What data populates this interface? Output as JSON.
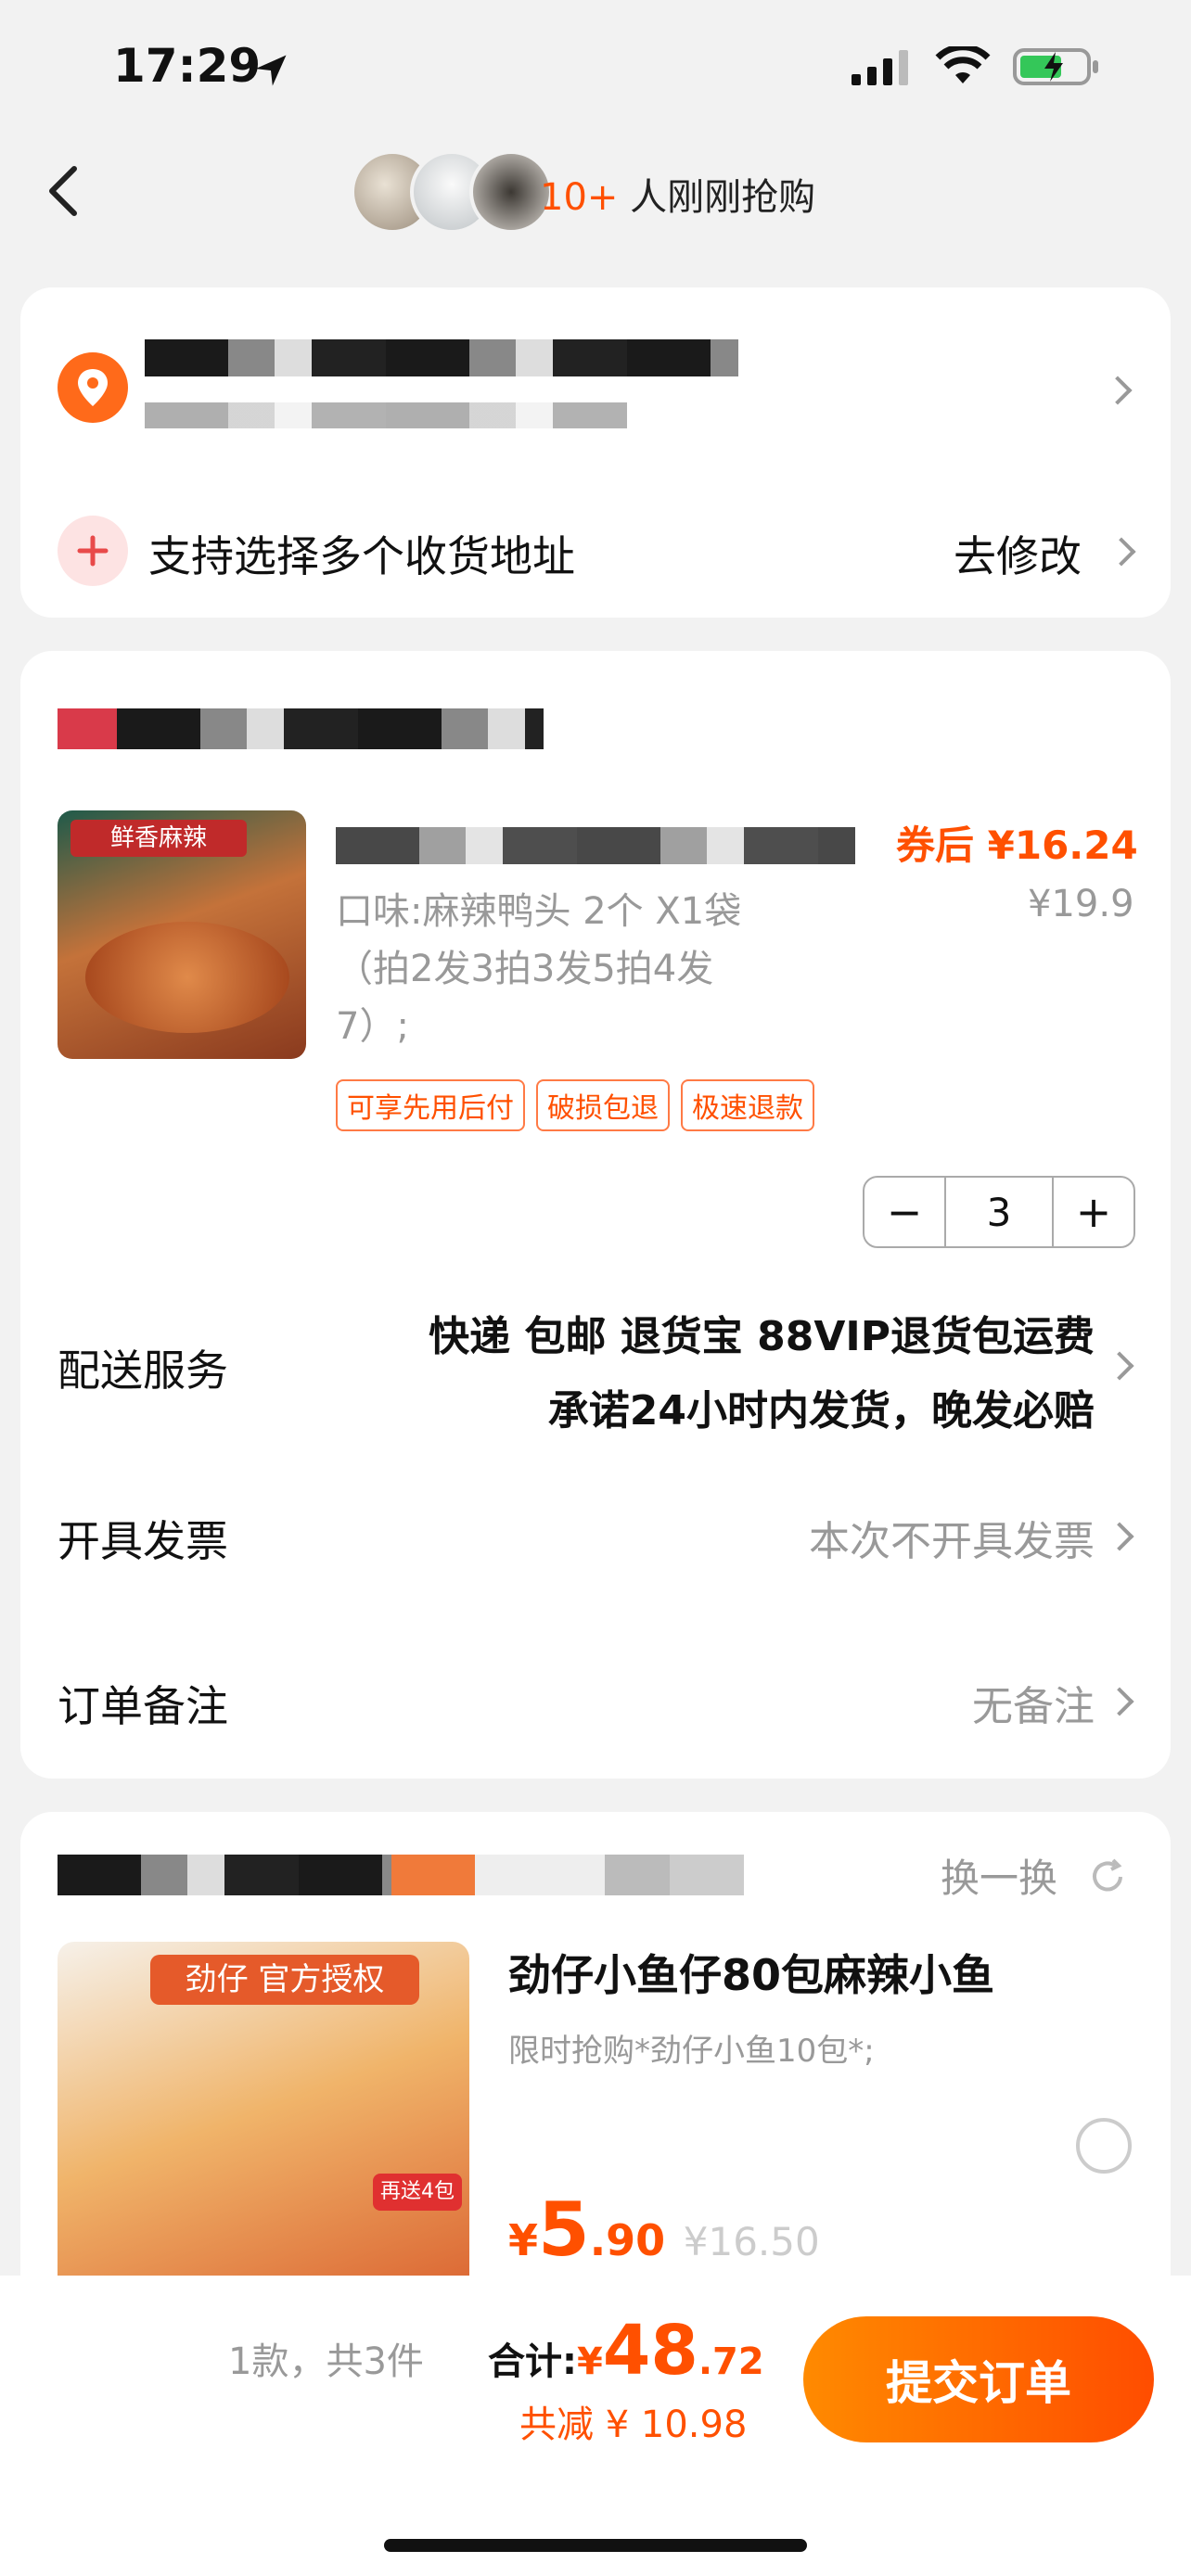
{
  "status": {
    "time": "17:29"
  },
  "header": {
    "count": "10+",
    "text": "人刚刚抢购"
  },
  "address": {
    "multi": "支持选择多个收货地址",
    "edit": "去修改"
  },
  "product": {
    "spec_line1": "口味:麻辣鸭头 2个 X1袋",
    "spec_line2": "（拍2发3拍3发5拍4发",
    "spec_line3": "7）;",
    "coupon_label": "券后",
    "price_after": "¥16.24",
    "price_orig": "¥19.9",
    "tags": [
      "可享先用后付",
      "破损包退",
      "极速退款"
    ],
    "quantity": "3",
    "image_caption": "鲜香麻辣"
  },
  "rows": {
    "delivery_label": "配送服务",
    "delivery_line1": "快递 包邮 退货宝 88VIP退货包运费",
    "delivery_line2": "承诺24小时内发货，晚发必赔",
    "invoice_label": "开具发票",
    "invoice_value": "本次不开具发票",
    "note_label": "订单备注",
    "note_value": "无备注"
  },
  "recommend": {
    "swap": "换一换",
    "title": "劲仔小鱼仔80包麻辣小鱼",
    "subtitle": "限时抢购*劲仔小鱼10包*;",
    "price_symbol": "¥",
    "price_int": "5",
    "price_dec": ".90",
    "price_orig": "¥16.50",
    "image_brand": "劲仔",
    "image_badge": "官方授权",
    "image_promo": "再送4包"
  },
  "footer": {
    "summary": "1款，共3件",
    "total_label": "合计:",
    "total_symbol": "¥",
    "total_int": "48",
    "total_dec": ".72",
    "saved": "共减 ¥ 10.98",
    "submit": "提交订单"
  },
  "colors": {
    "accent": "#ff5000",
    "price": "#ff5000",
    "muted": "#999999"
  }
}
